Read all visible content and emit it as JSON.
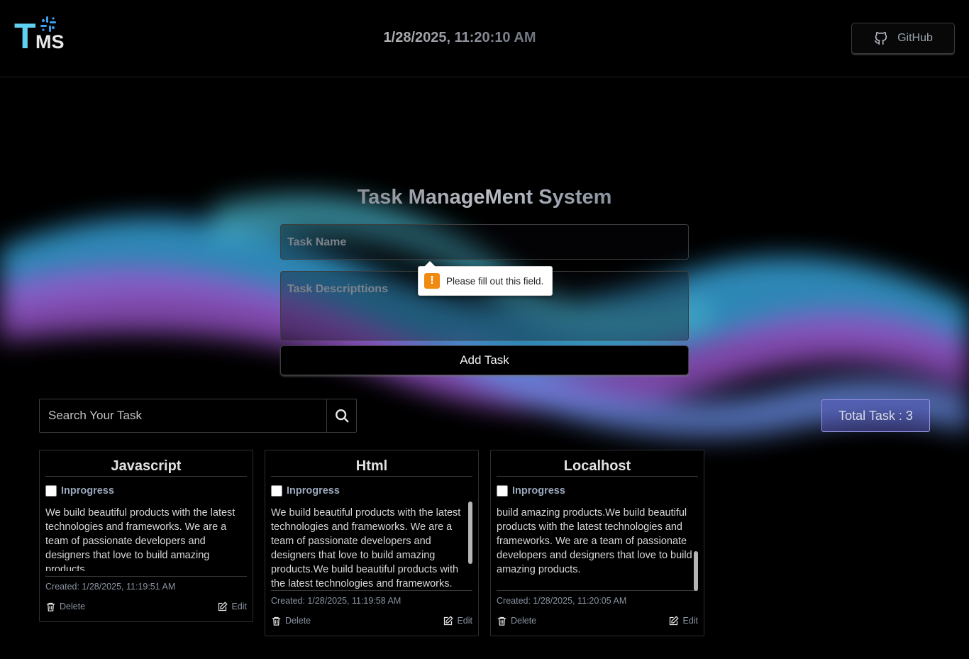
{
  "header": {
    "logo_main": "T",
    "logo_sub": "MS",
    "datetime": "1/28/2025, 11:20:10 AM",
    "github_label": "GitHub"
  },
  "form": {
    "title": "Task ManageMent System",
    "task_name_placeholder": "Task Name",
    "task_desc_placeholder": "Task Descripttions",
    "validation_message": "Please fill out this field.",
    "add_button_label": "Add Task"
  },
  "search": {
    "placeholder": "Search Your Task"
  },
  "total_label": "Total Task : 3",
  "tasks": [
    {
      "title": "Javascript",
      "status": "Inprogress",
      "description": "We build beautiful products with the latest technologies and frameworks. We are a team of passionate developers and designers that love to build amazing products.",
      "created": "Created: 1/28/2025, 11:19:51 AM",
      "delete_label": "Delete",
      "edit_label": "Edit"
    },
    {
      "title": "Html",
      "status": "Inprogress",
      "description": "We build beautiful products with the latest technologies and frameworks. We are a team of passionate developers and designers that love to build amazing products.We build beautiful products with the latest technologies and frameworks. We are a team of passionate",
      "created": "Created: 1/28/2025, 11:19:58 AM",
      "delete_label": "Delete",
      "edit_label": "Edit"
    },
    {
      "title": "Localhost",
      "status": "Inprogress",
      "description": "build amazing products.We build beautiful products with the latest technologies and frameworks. We are a team of passionate developers and designers that love to build amazing products.",
      "created": "Created: 1/28/2025, 11:20:05 AM",
      "delete_label": "Delete",
      "edit_label": "Edit"
    }
  ],
  "colors": {
    "accent_cyan": "#5fd0f0",
    "warning_orange": "#f08a10",
    "total_badge": "#6060c8"
  },
  "icons": [
    "logo-mark-icon",
    "github-icon",
    "search-icon",
    "warning-icon",
    "trash-icon",
    "edit-icon"
  ]
}
